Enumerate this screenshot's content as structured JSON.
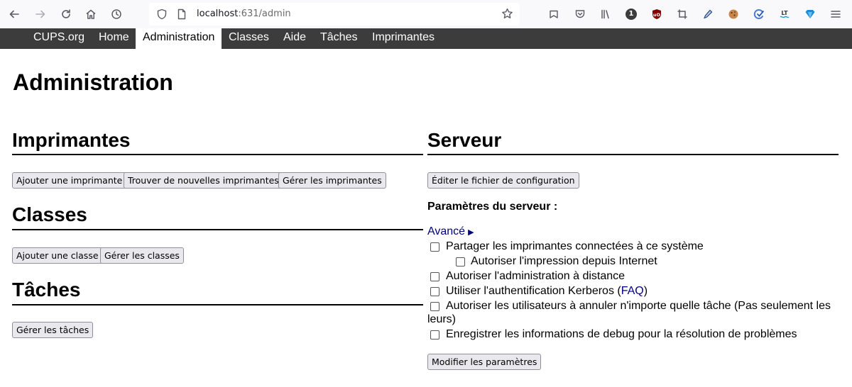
{
  "browser": {
    "url_host": "localhost",
    "url_path": ":631/admin",
    "extensions": [
      "library-icon",
      "1"
    ]
  },
  "nav": {
    "items": [
      {
        "label": "CUPS.org"
      },
      {
        "label": "Home"
      },
      {
        "label": "Administration",
        "active": true
      },
      {
        "label": "Classes"
      },
      {
        "label": "Aide"
      },
      {
        "label": "Tâches"
      },
      {
        "label": "Imprimantes"
      }
    ]
  },
  "page": {
    "title": "Administration"
  },
  "printers": {
    "heading": "Imprimantes",
    "buttons": [
      "Ajouter une imprimante",
      "Trouver de nouvelles imprimantes",
      "Gérer les imprimantes"
    ]
  },
  "classes": {
    "heading": "Classes",
    "buttons": [
      "Ajouter une classe",
      "Gérer les classes"
    ]
  },
  "jobs": {
    "heading": "Tâches",
    "buttons": [
      "Gérer les tâches"
    ]
  },
  "server": {
    "heading": "Serveur",
    "edit_config": "Éditer le fichier de configuration",
    "settings_label": "Paramètres du serveur :",
    "advanced": "Avancé",
    "options": [
      {
        "label": "Partager les imprimantes connectées à ce système"
      },
      {
        "label": "Autoriser l'impression depuis Internet"
      },
      {
        "label": "Autoriser l'administration à distance"
      },
      {
        "label_before": "Utiliser l'authentification Kerberos (",
        "link": "FAQ",
        "label_after": ")"
      },
      {
        "label": "Autoriser les utilisateurs à annuler n'importe quelle tâche (Pas seulement les",
        "label_cont": "leurs)"
      },
      {
        "label": "Enregistrer les informations de debug pour la résolution de problèmes"
      }
    ],
    "submit": "Modifier les paramètres"
  },
  "colors": {
    "header_bg": "#3c3c3c",
    "link": "#000080",
    "toolbar_bg": "#f9f9fb"
  }
}
